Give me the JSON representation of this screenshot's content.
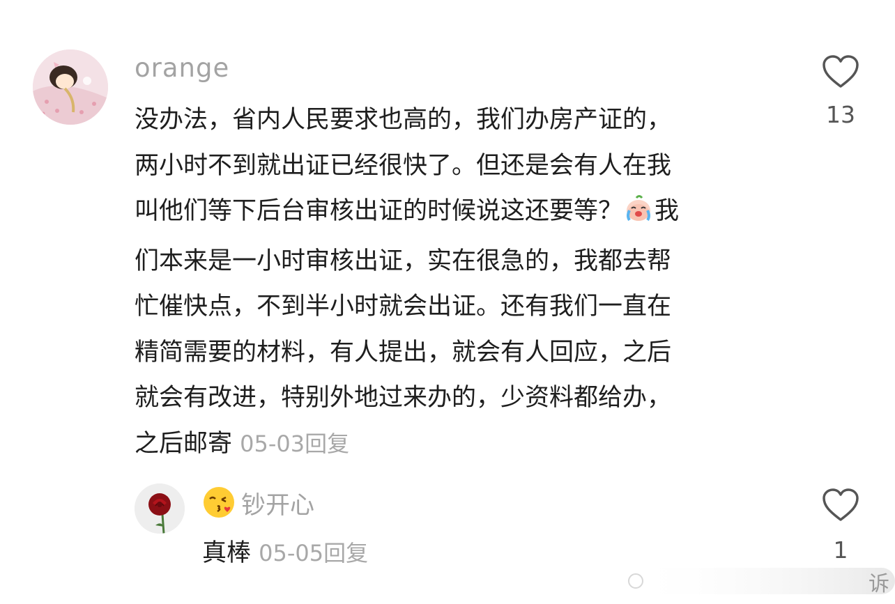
{
  "comment": {
    "username": "orange",
    "lines": [
      "没办法，省内人民要求也高的，我们办房产证的，",
      "两小时不到就出证已经很快了。但还是会有人在我",
      "叫他们等下后台审核出证的时候说这还要等？",
      "们本来是一小时审核出证，实在很急的，我都去帮",
      "忙催快点，不到半小时就会出证。还有我们一直在",
      "精简需要的材料，有人提出，就会有人回应，之后",
      "就会有改进，特别外地过来办的，少资料都给办，",
      "之后邮寄"
    ],
    "line3_tail": "我",
    "date": "05-03",
    "reply_label": "回复",
    "likes": "13"
  },
  "reply": {
    "username": "钞开心",
    "text": "真棒",
    "date": "05-05",
    "reply_label": "回复",
    "likes": "1"
  },
  "watermark": {
    "text": "诉"
  },
  "icons": {
    "like": "heart-outline-icon",
    "crying_emoji": "crying-face-icon",
    "kiss_emoji": "kissing-face-icon"
  }
}
